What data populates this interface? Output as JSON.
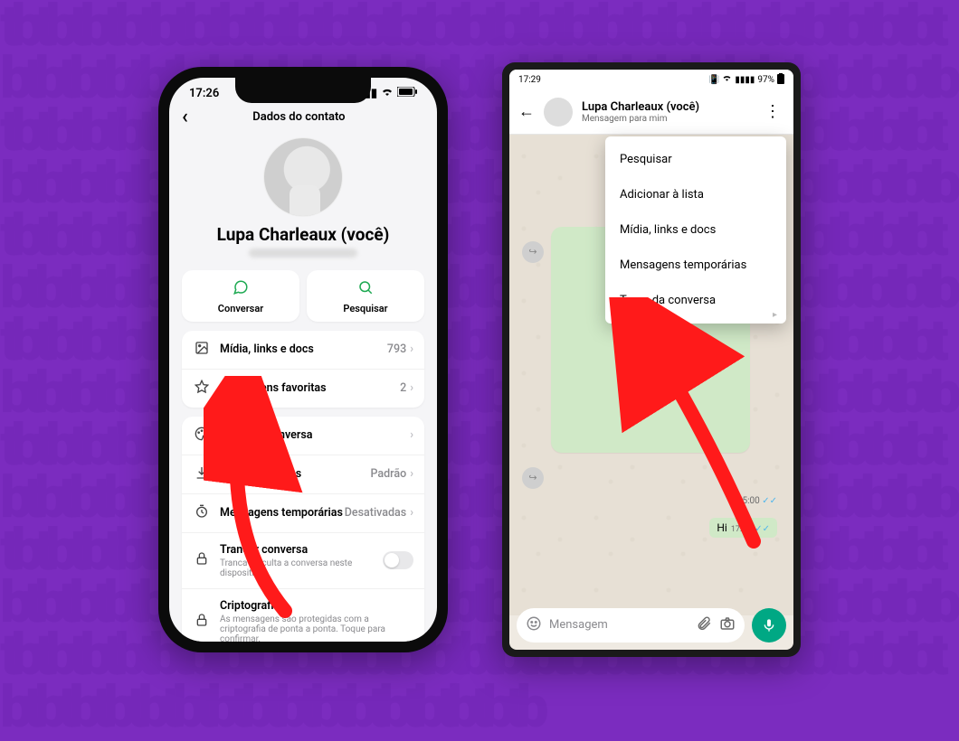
{
  "iphone": {
    "status": {
      "time": "17:26"
    },
    "header": {
      "title": "Dados do contato"
    },
    "contact": {
      "name": "Lupa Charleaux (você)"
    },
    "actions": {
      "chat_label": "Conversar",
      "search_label": "Pesquisar"
    },
    "group1": {
      "media": {
        "label": "Mídia, links e docs",
        "value": "793"
      },
      "starred": {
        "label": "Mensagens favoritas",
        "value": "2"
      }
    },
    "group2": {
      "theme": {
        "label": "Tema da conversa"
      },
      "photos": {
        "label": "Salvar em Fotos",
        "value": "Padrão"
      },
      "disappearing": {
        "label": "Mensagens temporárias",
        "value": "Desativadas"
      },
      "lock": {
        "label": "Trancar conversa",
        "sub": "Tranca e oculta a conversa neste dispositivo."
      },
      "crypto": {
        "label": "Criptografia",
        "sub": "As mensagens são protegidas com a criptografia de ponta a ponta. Toque para confirmar."
      }
    }
  },
  "android": {
    "status": {
      "time": "17:29",
      "battery": "97%"
    },
    "header": {
      "name": "Lupa Charleaux (você)",
      "sub": "Mensagem para mim"
    },
    "dropdown": {
      "search": "Pesquisar",
      "addlist": "Adicionar à lista",
      "media": "Mídia, links e docs",
      "disappearing": "Mensagens temporárias",
      "theme": "Tema da conversa"
    },
    "chat": {
      "time1": "15:00",
      "msg_hi": "Hi",
      "msg_hi_time": "17:26"
    },
    "input": {
      "placeholder": "Mensagem"
    }
  }
}
